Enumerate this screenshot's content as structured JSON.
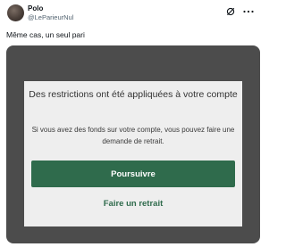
{
  "tweet": {
    "author_name": "Polo",
    "author_handle": "@LeParieurNul",
    "text": "Même cas, un seul pari",
    "icons": {
      "grok": "grok-icon",
      "more": "more-horizontal-icon"
    }
  },
  "dialog": {
    "title": "Des restrictions ont été appliquées à votre compte",
    "body": "Si vous avez des fonds sur votre compte, vous pouvez faire une demande de retrait.",
    "primary_button": "Poursuivre",
    "secondary_link": "Faire un retrait"
  },
  "colors": {
    "accent": "#2f6b4c",
    "media_background": "#4c4c4c",
    "dialog_background": "#eeeeee"
  }
}
